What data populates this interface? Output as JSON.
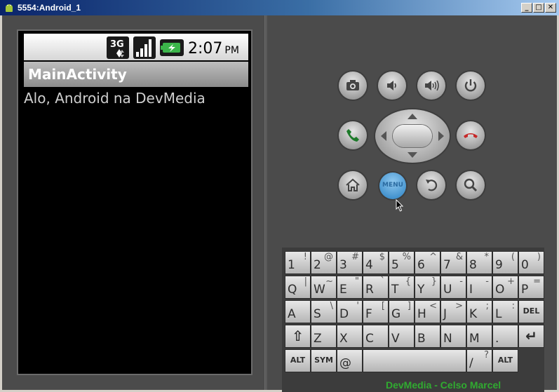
{
  "window": {
    "title": "5554:Android_1",
    "minimize_label": "_",
    "maximize_label": "□",
    "close_label": "✕"
  },
  "device": {
    "status_bar": {
      "network": "3G",
      "time": "2:07",
      "ampm": "PM"
    },
    "app_title": "MainActivity",
    "content_text": "Alo, Android na DevMedia"
  },
  "hardware_buttons": {
    "menu_label": "MENU",
    "icons": [
      "camera-icon",
      "volume-down-icon",
      "volume-up-icon",
      "power-icon",
      "call-icon",
      "end-call-icon",
      "home-icon",
      "menu-icon",
      "back-icon",
      "search-icon"
    ]
  },
  "keyboard": {
    "rows": [
      [
        {
          "m": "1",
          "a": "!"
        },
        {
          "m": "2",
          "a": "@"
        },
        {
          "m": "3",
          "a": "#"
        },
        {
          "m": "4",
          "a": "$"
        },
        {
          "m": "5",
          "a": "%"
        },
        {
          "m": "6",
          "a": "^"
        },
        {
          "m": "7",
          "a": "&"
        },
        {
          "m": "8",
          "a": "*"
        },
        {
          "m": "9",
          "a": "("
        },
        {
          "m": "0",
          "a": ")"
        }
      ],
      [
        {
          "m": "Q",
          "a": "|"
        },
        {
          "m": "W",
          "a": "~"
        },
        {
          "m": "E",
          "a": "\""
        },
        {
          "m": "R",
          "a": "`"
        },
        {
          "m": "T",
          "a": "{"
        },
        {
          "m": "Y",
          "a": "}"
        },
        {
          "m": "U",
          "a": "-"
        },
        {
          "m": "I",
          "a": "-"
        },
        {
          "m": "O",
          "a": "+"
        },
        {
          "m": "P",
          "a": "="
        }
      ],
      [
        {
          "m": "A",
          "a": ""
        },
        {
          "m": "S",
          "a": "\\"
        },
        {
          "m": "D",
          "a": "'"
        },
        {
          "m": "F",
          "a": "["
        },
        {
          "m": "G",
          "a": "]"
        },
        {
          "m": "H",
          "a": "<"
        },
        {
          "m": "J",
          "a": ">"
        },
        {
          "m": "K",
          "a": ";"
        },
        {
          "m": "L",
          "a": ":"
        },
        {
          "m": "DEL",
          "a": ""
        }
      ],
      [
        {
          "m": "⇧",
          "a": ""
        },
        {
          "m": "Z",
          "a": ""
        },
        {
          "m": "X",
          "a": ""
        },
        {
          "m": "C",
          "a": ""
        },
        {
          "m": "V",
          "a": ""
        },
        {
          "m": "B",
          "a": ""
        },
        {
          "m": "N",
          "a": ""
        },
        {
          "m": "M",
          "a": ""
        },
        {
          "m": ".",
          "a": ""
        },
        {
          "m": "↵",
          "a": ""
        }
      ],
      [
        {
          "m": "ALT",
          "a": ""
        },
        {
          "m": "SYM",
          "a": ""
        },
        {
          "m": "@",
          "a": ""
        },
        {
          "m": "",
          "a": ""
        },
        {
          "m": "/",
          "a": "?"
        },
        {
          "m": "ALT",
          "a": ""
        }
      ]
    ],
    "watermark": "DevMedia - Celso Marcel"
  }
}
